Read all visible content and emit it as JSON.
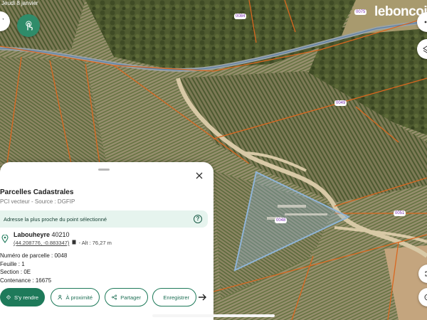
{
  "status_bar": {
    "time": "Jeudi 8 janvier"
  },
  "brand": {
    "name": "leboncoin"
  },
  "map": {
    "parcel_labels": [
      "0084",
      "0075",
      "0049",
      "0048",
      "0051"
    ],
    "parcel_line_color": "#d9671f",
    "selected_parcel_color": "#8fb4d6"
  },
  "panel": {
    "title": "Parcelles Cadastrales",
    "subtitle": "PCI vecteur - Source : DGFIP",
    "banner_text": "Adresse la plus proche du point sélectionné",
    "location": {
      "city": "Labouheyre",
      "postcode": "40210",
      "coords": "(44.208776, -0.883347)",
      "altitude": "- Alt : 76,27 m"
    },
    "info": {
      "parcel_number": "Numéro de parcelle : 0048",
      "sheet": "Feuille : 1",
      "section": "Section : 0E",
      "area": "Contenance : 16675"
    },
    "actions": {
      "directions": "S'y rendre",
      "nearby": "À proximité",
      "share": "Partager",
      "save": "Enregistrer"
    }
  },
  "icons": [
    "touch-tool-icon",
    "close-icon",
    "help-icon",
    "location-pin-icon",
    "copy-icon",
    "directions-icon",
    "person-icon",
    "share-icon",
    "bookmark-shield-icon",
    "arrow-right-icon",
    "layers-icon",
    "expand-icon",
    "target-icon"
  ],
  "colors": {
    "accent": "#1e7a5a",
    "banner_bg": "#e6f4ee",
    "label_text": "#7a2fb0"
  }
}
